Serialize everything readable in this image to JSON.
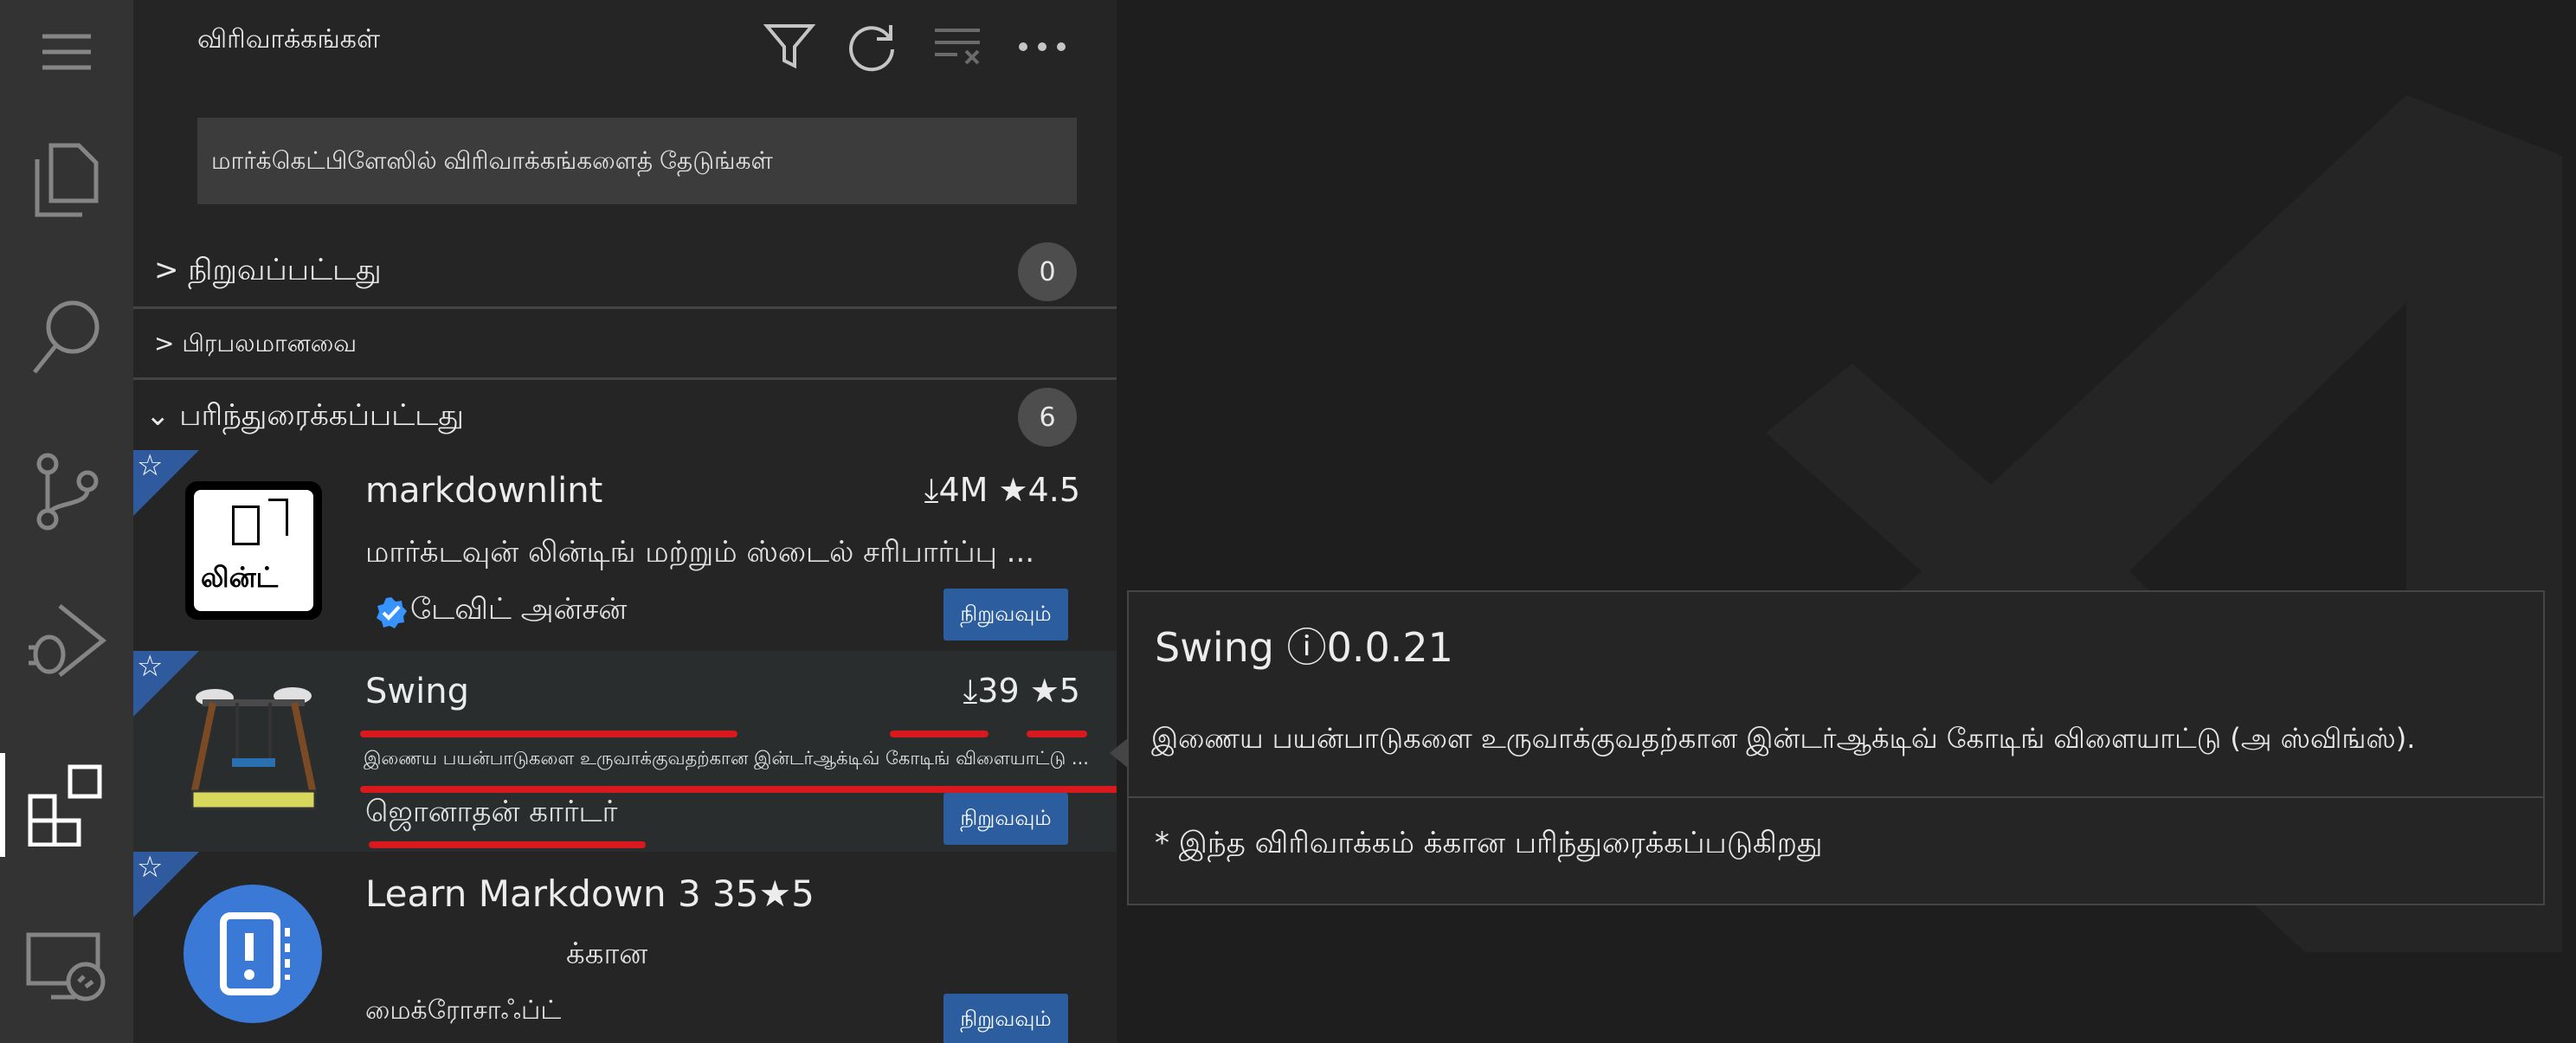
{
  "sidebar": {
    "title": "விரிவாக்கங்கள்",
    "search_placeholder": "மார்க்கெட்பிளேஸில் விரிவாக்கங்களைத் தேடுங்கள்",
    "sections": {
      "installed": {
        "label": "> நிறுவப்பட்டது",
        "count": "0"
      },
      "popular": {
        "label": "> பிரபலமானவை"
      },
      "recommended": {
        "label": "⌄ பரிந்துரைக்கப்பட்டது",
        "count": "6"
      }
    },
    "extensions": [
      {
        "name": "markdownlint",
        "meta": "⤓4M ★4.5",
        "description": "மார்க்டவுன் லின்டிங் மற்றும் ஸ்டைல் சரிபார்ப்பு ...",
        "publisher": "டேவிட் அன்சன்",
        "install_label": "நிறுவவும்",
        "logo_text": "லின்ட்"
      },
      {
        "name": "Swing",
        "meta": "⤓39 ★5",
        "description": "இணைய பயன்பாடுகளை உருவாக்குவதற்கான இன்டர்ஆக்டிவ் கோடிங் விளையாட்டு ...",
        "publisher": "ஜொனாதன் கார்டர்",
        "install_label": "நிறுவவும்"
      },
      {
        "name": "Learn Markdown 3 35★5",
        "meta": "",
        "description": "க்கான",
        "publisher": "மைக்ரோசாஃப்ட்",
        "install_label": "நிறுவவும்"
      }
    ]
  },
  "hover": {
    "title": "Swing ⓘ0.0.21",
    "description": "இணைய பயன்பாடுகளை உருவாக்குவதற்கான இன்டர்ஆக்டிவ் கோடிங் விளையாட்டு (அ ஸ்விங்ஸ்).",
    "note": "* இந்த விரிவாக்கம் க்கான பரிந்துரைக்கப்படுகிறது"
  },
  "colors": {
    "activity_bar": "#333333",
    "sidebar": "#252526",
    "editor": "#1e1e1e",
    "accent_install": "#2c5d9e",
    "ribbon": "#2f5b9e",
    "underline_red": "#d8191e"
  },
  "icons": [
    "menu-icon",
    "files-icon",
    "search-icon",
    "source-control-icon",
    "run-debug-icon",
    "extensions-icon",
    "remote-explorer-icon",
    "filter-icon",
    "refresh-icon",
    "clear-icon",
    "more-icon",
    "star-icon",
    "verified-icon"
  ]
}
